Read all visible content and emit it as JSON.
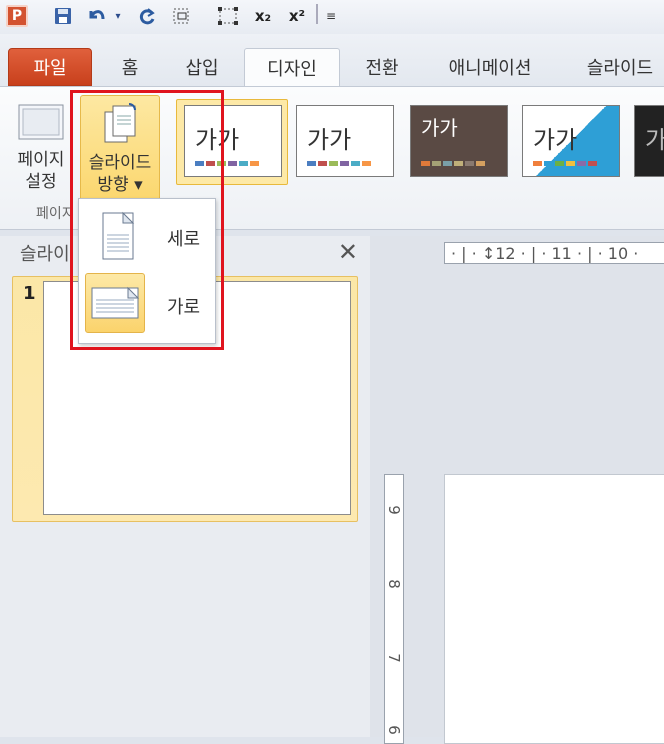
{
  "quick_access": {
    "app_icon_letter": "P",
    "subscript_label": "x₂",
    "superscript_label": "x²"
  },
  "tabs": [
    "파일",
    "홈",
    "삽입",
    "디자인",
    "전환",
    "애니메이션",
    "슬라이드"
  ],
  "ribbon": {
    "page_setup_line1": "페이지",
    "page_setup_line2": "설정",
    "orientation_line1": "슬라이드",
    "orientation_line2": "방향 ▾",
    "group_label": "페이지",
    "themes": [
      {
        "label": "가가",
        "bg": "#ffffff",
        "text": "#333333"
      },
      {
        "label": "가가",
        "bg": "#ffffff",
        "text": "#333333"
      },
      {
        "label": "가가",
        "bg": "#5a4a44",
        "text": "#ffffff"
      },
      {
        "label": "가가",
        "bg": "#2e9fd6",
        "text": "#333333"
      },
      {
        "label": "가",
        "bg": "#222222",
        "text": "#bbbbbb"
      }
    ]
  },
  "dropdown": {
    "portrait": "세로",
    "landscape": "가로"
  },
  "slides_pane": {
    "tab_label": "슬라이",
    "close": "✕",
    "slide_number": "1"
  },
  "rulers": {
    "horizontal": "· | · ↕12 · | · 11 · | · 10 ·",
    "vertical_numbers": [
      "9",
      "8",
      "7",
      "6"
    ]
  },
  "colors": {
    "accent": "#d35230",
    "highlight": "#e0141e",
    "selection": "#fde9a7"
  }
}
